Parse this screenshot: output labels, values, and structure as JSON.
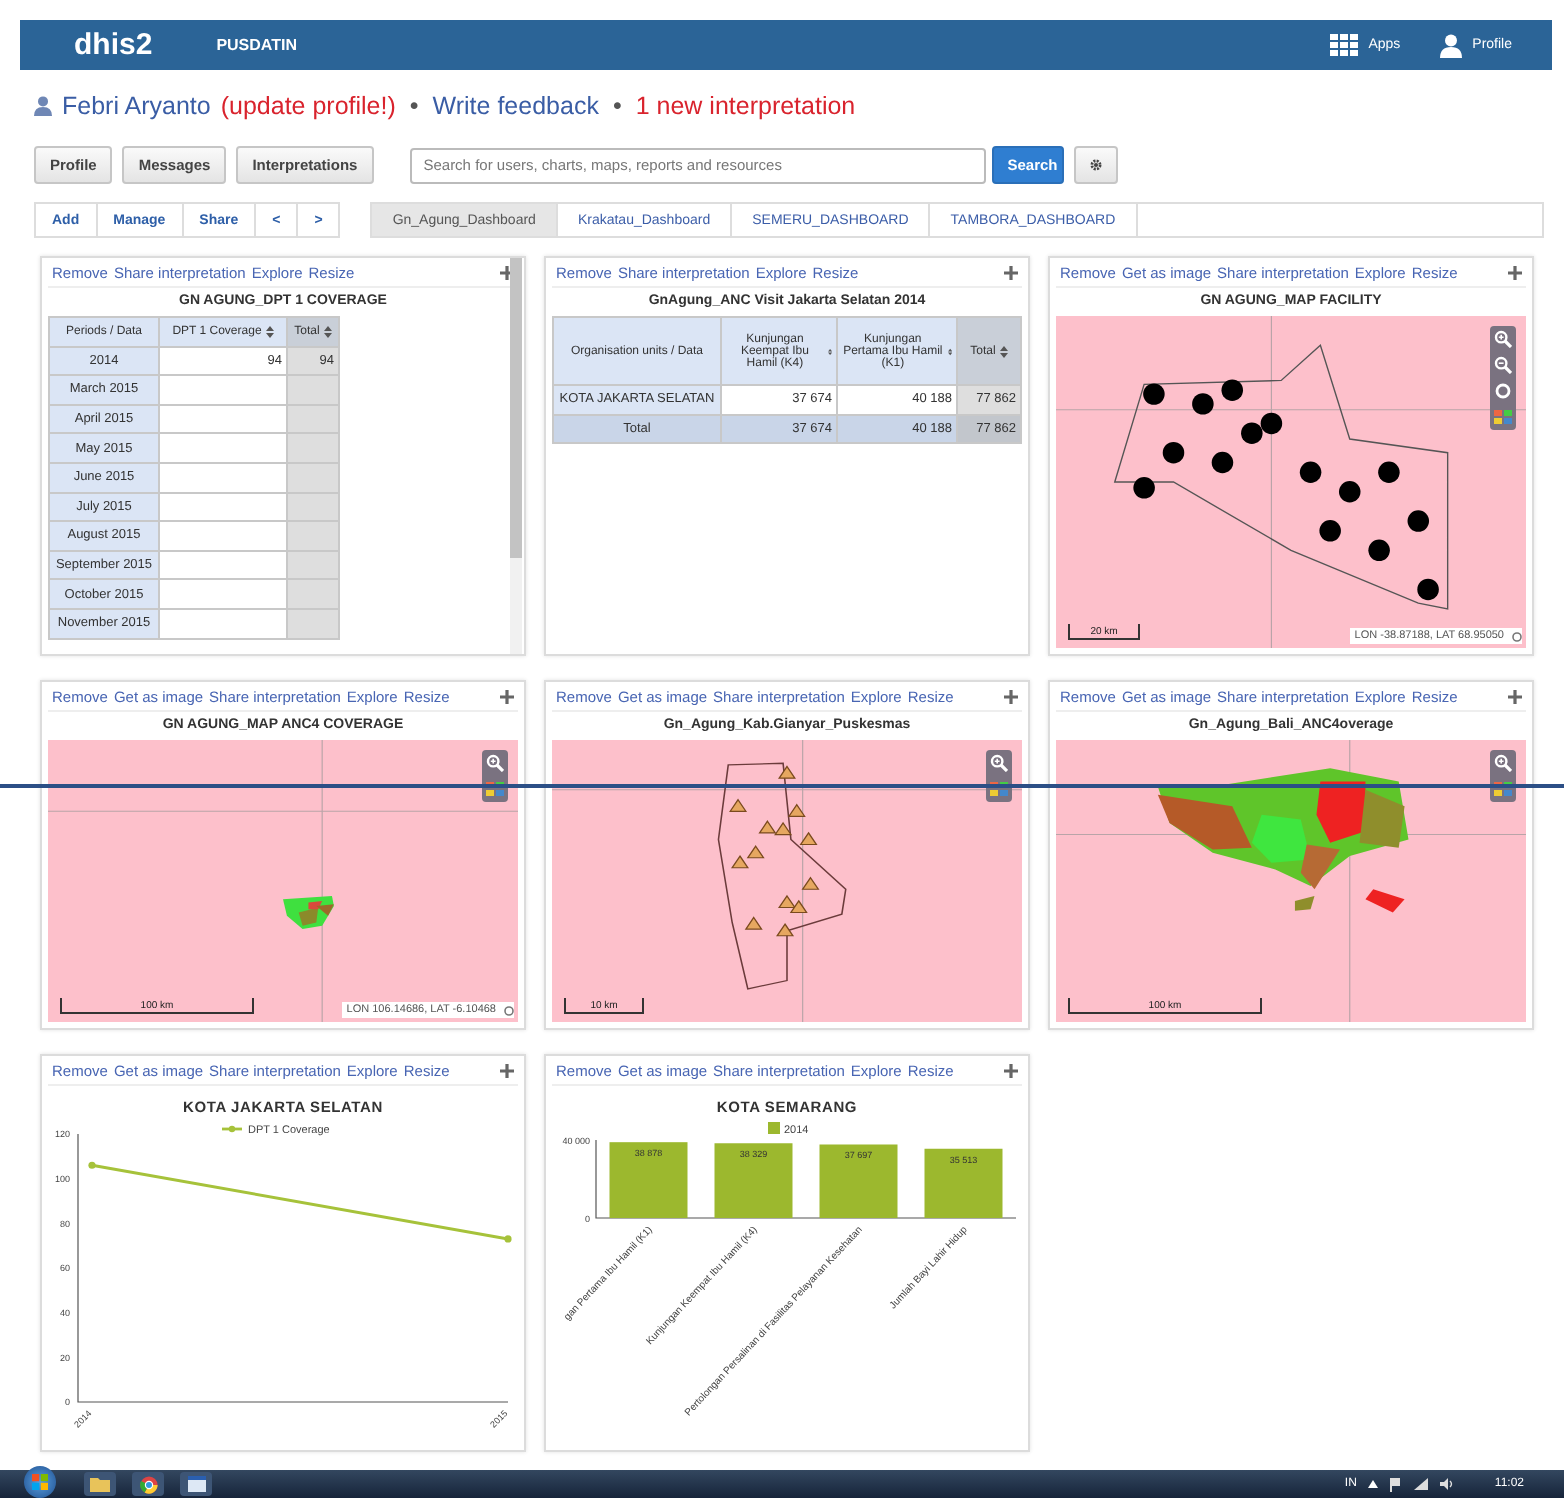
{
  "header": {
    "logo": "dhis2",
    "instance": "PUSDATIN",
    "apps": "Apps",
    "profile": "Profile"
  },
  "user_line": [
    {
      "kind": "name",
      "text": "Febri Aryanto"
    },
    {
      "kind": "alert",
      "text": "(update profile!)"
    },
    {
      "kind": "bullet",
      "text": "•"
    },
    {
      "kind": "link",
      "text": "Write feedback"
    },
    {
      "kind": "bullet",
      "text": "•"
    },
    {
      "kind": "notice",
      "text": "1 new interpretation"
    }
  ],
  "profile_buttons": [
    "Profile",
    "Messages",
    "Interpretations"
  ],
  "search": {
    "placeholder": "Search for users, charts, maps, reports and resources",
    "button": "Search"
  },
  "dashboard_actions": [
    "Add",
    "Manage",
    "Share",
    "<",
    ">"
  ],
  "dashboards": [
    {
      "label": "Gn_Agung_Dashboard",
      "selected": true
    },
    {
      "label": "Krakatau_Dashboard",
      "selected": false
    },
    {
      "label": "SEMERU_DASHBOARD",
      "selected": false
    },
    {
      "label": "TAMBORA_DASHBOARD",
      "selected": false
    }
  ],
  "items": [
    {
      "kind": "pivot",
      "actions": [
        "Remove",
        "Share interpretation",
        "Explore",
        "Resize"
      ],
      "title": "GN AGUNG_DPT 1 COVERAGE",
      "columns": [
        "Periods / Data",
        "DPT 1 Coverage",
        "Total"
      ],
      "rows": [
        {
          "cells": [
            "2014",
            "94",
            "94"
          ]
        },
        {
          "cells": [
            "March 2015"
          ]
        },
        {
          "cells": [
            "April 2015"
          ]
        },
        {
          "cells": [
            "May 2015"
          ]
        },
        {
          "cells": [
            "June 2015"
          ]
        },
        {
          "cells": [
            "July 2015"
          ]
        },
        {
          "cells": [
            "August 2015"
          ]
        },
        {
          "cells": [
            "September 2015"
          ]
        },
        {
          "cells": [
            "October 2015"
          ]
        },
        {
          "cells": [
            "November 2015"
          ]
        }
      ]
    },
    {
      "kind": "pivot",
      "actions": [
        "Remove",
        "Share interpretation",
        "Explore",
        "Resize"
      ],
      "title": "GnAgung_ANC Visit Jakarta Selatan 2014",
      "columns": [
        "Organisation units / Data",
        "Kunjungan Keempat Ibu Hamil (K4)",
        "Kunjungan Pertama Ibu Hamil (K1)",
        "Total"
      ],
      "rows": [
        {
          "kind": "data",
          "cells": [
            "KOTA JAKARTA SELATAN",
            "37 674",
            "40 188",
            "77 862"
          ]
        },
        {
          "kind": "total",
          "cells": [
            "Total",
            "37 674",
            "40 188",
            "77 862"
          ]
        }
      ]
    },
    {
      "kind": "map",
      "actions": [
        "Remove",
        "Get as image",
        "Share interpretation",
        "Explore",
        "Resize"
      ],
      "title": "GN AGUNG_MAP FACILITY",
      "tools": [
        {
          "kind": "zoom-in"
        },
        {
          "kind": "zoom-out"
        },
        {
          "kind": "locate"
        },
        {
          "kind": "legend"
        }
      ],
      "scale": "20 km",
      "coordinates": "LON -38.87188, LAT 68.95050"
    },
    {
      "kind": "map",
      "actions": [
        "Remove",
        "Get as image",
        "Share interpretation",
        "Explore",
        "Resize"
      ],
      "title": "GN AGUNG_MAP ANC4 COVERAGE",
      "tools": [
        {
          "kind": "zoom-in"
        },
        {
          "kind": "legend"
        }
      ],
      "scale": "100 km",
      "coordinates": "LON 106.14686, LAT -6.10468"
    },
    {
      "kind": "map",
      "actions": [
        "Remove",
        "Get as image",
        "Share interpretation",
        "Explore",
        "Resize"
      ],
      "title": "Gn_Agung_Kab.Gianyar_Puskesmas",
      "tools": [
        {
          "kind": "zoom-in"
        },
        {
          "kind": "legend"
        }
      ],
      "scale": "10 km"
    },
    {
      "kind": "map",
      "actions": [
        "Remove",
        "Get as image",
        "Share interpretation",
        "Explore",
        "Resize"
      ],
      "title": "Gn_Agung_Bali_ANC4overage",
      "tools": [
        {
          "kind": "zoom-in"
        },
        {
          "kind": "legend"
        }
      ],
      "scale": "100 km"
    },
    {
      "kind": "chart",
      "actions": [
        "Remove",
        "Get as image",
        "Share interpretation",
        "Explore",
        "Resize"
      ],
      "chart_data": {
        "type": "line",
        "title": "KOTA JAKARTA SELATAN",
        "categories": [
          "2014",
          "2015"
        ],
        "series": [
          {
            "name": "DPT 1 Coverage",
            "color": "#a6c23a",
            "marker": "circle",
            "values": [
              106,
              73
            ]
          }
        ],
        "ylim": [
          0,
          120
        ],
        "yticks": [
          0,
          20,
          40,
          60,
          80,
          100,
          120
        ]
      }
    },
    {
      "kind": "chart",
      "actions": [
        "Remove",
        "Get as image",
        "Share interpretation",
        "Explore",
        "Resize"
      ],
      "chart_data": {
        "type": "bar",
        "title": "KOTA SEMARANG",
        "categories": [
          "gan Pertama Ibu Hamil (K1)",
          "Kunjungan Keempat Ibu Hamil (K4)",
          "Pertolongan Persalinan di Fasilitas Pelayanan Kesehatan",
          "Jumlah Bayi Lahir Hidup"
        ],
        "series": [
          {
            "name": "2014",
            "color": "#9cb82e",
            "values": [
              38878,
              38329,
              37697,
              35513
            ]
          }
        ],
        "ylim": [
          0,
          40000
        ],
        "yticks": [
          {
            "value": 0,
            "label": "0"
          },
          {
            "value": 40000,
            "label": "40 000"
          }
        ],
        "data_labels": true
      }
    }
  ],
  "taskbar": {
    "language": "IN",
    "clock": "11:02"
  }
}
